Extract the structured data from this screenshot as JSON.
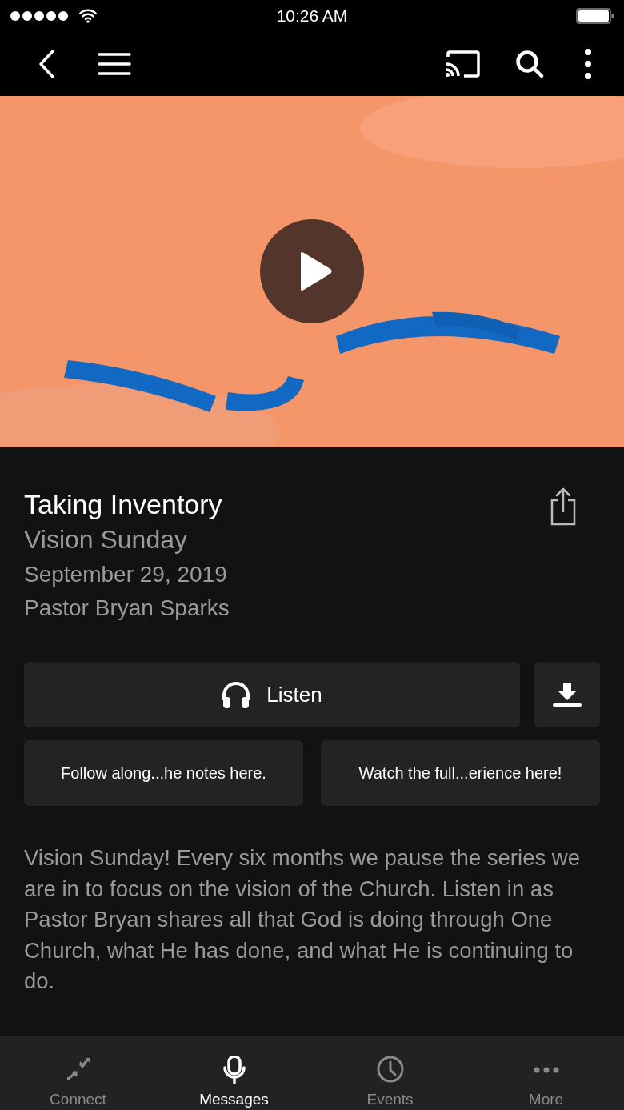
{
  "status_bar": {
    "time": "10:26 AM"
  },
  "message": {
    "title": "Taking Inventory",
    "series": "Vision Sunday",
    "date": "September 29, 2019",
    "speaker": "Pastor Bryan Sparks"
  },
  "listen_button": {
    "label": "Listen"
  },
  "links": [
    {
      "label": "Follow along...he notes here."
    },
    {
      "label": "Watch the full...erience here!"
    }
  ],
  "description": "Vision Sunday! Every six months we pause the series we are in to focus on the vision of the Church. Listen in as Pastor Bryan shares all that God is doing through One Church, what He has done, and what He is continuing to do.",
  "tab_bar": [
    {
      "label": "Connect",
      "selected": false
    },
    {
      "label": "Messages",
      "selected": true
    },
    {
      "label": "Events",
      "selected": false
    },
    {
      "label": "More",
      "selected": false
    }
  ]
}
